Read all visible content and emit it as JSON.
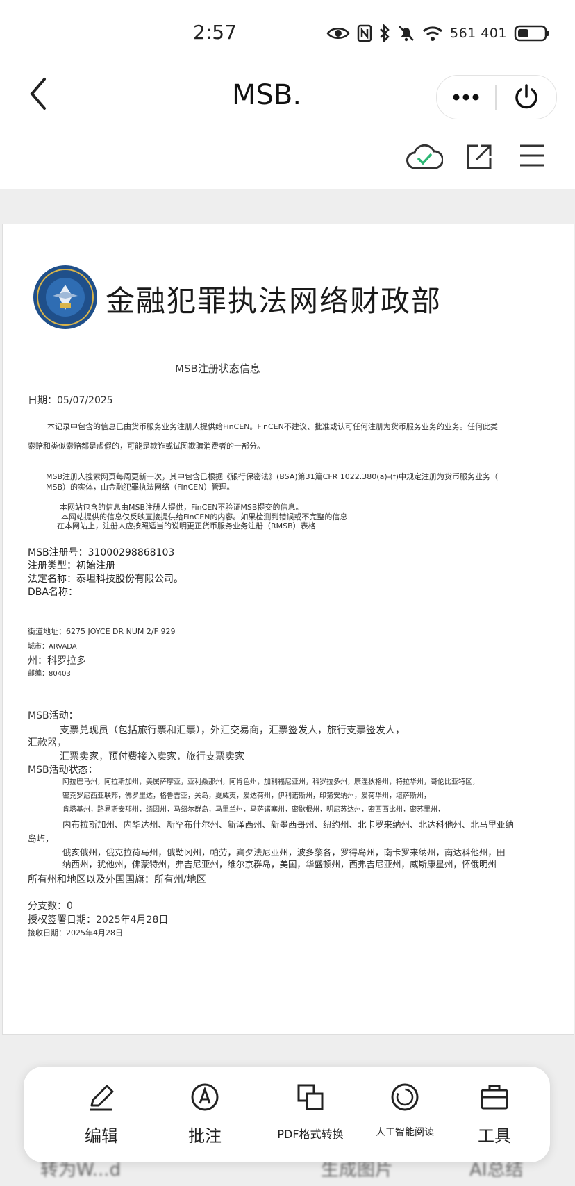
{
  "status_bar": {
    "time": "2:57",
    "network_speed": "561 401"
  },
  "header": {
    "back_icon": "chevron-left-icon",
    "title": "MSB.",
    "more_icon": "more-dots-icon",
    "power_icon": "power-icon",
    "cloud_icon": "cloud-check-icon",
    "share_icon": "share-icon",
    "menu_icon": "menu-icon",
    "cloud_color": "#2bb673"
  },
  "document": {
    "agency_title": "金融犯罪执法网络财政部",
    "seal_lettering": "U.S. TREASURY · FINANCIAL CRIMES ENFORCEMENT NETWORK",
    "subtitle": "MSB注册状态信息",
    "date_line": "日期：05/07/2025",
    "intro_line1": "本记录中包含的信息已由货币服务业务注册人提供给FinCEN。FinCEN不建议、批准或认可任何注册为货币服务业务的业务。任何此类",
    "intro_line2": "索赔和类似索赔都是虚假的，可能是欺诈或试图欺骗消费者的一部分。",
    "search_line1": "MSB注册人搜索网页每周更新一次，其中包含已根据《银行保密法》(BSA)第31篇CFR 1022.380(a)-(f)中规定注册为货币服务业务（",
    "search_line2": "MSB）的实体，由金融犯罪执法网络（FinCEN）管理。",
    "note_line1": "本网站包含的信息由MSB注册人提供，FinCEN不验证MSB提交的信息。",
    "note_line2": "本网站提供的信息仅反映直接提供给FinCEN的内容。如果检测到错误或不完整的信息",
    "note_line3": "在本网站上，注册人应按照适当的说明更正货币服务业务注册（RMSB）表格",
    "reg_number": "MSB注册号：31000298868103",
    "reg_type": "注册类型：初始注册",
    "legal_name": "法定名称：泰坦科技股份有限公司。",
    "dba_name": "DBA名称：",
    "street": "街道地址：6275 JOYCE DR NUM 2/F 929",
    "city": "城市：ARVADA",
    "state": "州：科罗拉多",
    "zip": "邮编：80403",
    "activities_label": "MSB活动：",
    "activities_line1": "支票兑现员（包括旅行票和汇票），外汇交易商，汇票签发人，旅行支票签发人，",
    "activities_line2": "汇款器，",
    "activities_line3": "汇票卖家，预付费接入卖家，旅行支票卖家",
    "status_label": "MSB活动状态：",
    "states_line1": "阿拉巴马州，阿拉斯加州，美属萨摩亚，亚利桑那州，阿肯色州，加利福尼亚州，科罗拉多州，康涅狄格州，特拉华州，哥伦比亚特区，",
    "states_line2": "密克罗尼西亚联邦，佛罗里达，格鲁吉亚，关岛，夏威夷，爱达荷州，伊利诺斯州，印第安纳州，爱荷华州，堪萨斯州，",
    "states_line3": "肯塔基州，路易斯安那州，缅因州，马绍尔群岛，马里兰州，马萨诸塞州，密歇根州，明尼苏达州，密西西比州，密苏里州，",
    "states_line4": "内布拉斯加州、内华达州、新罕布什尔州、新泽西州、新墨西哥州、纽约州、北卡罗来纳州、北达科他州、北马里亚纳",
    "states_line5": "岛屿，",
    "states_line6": "俄亥俄州，俄克拉荷马州，俄勒冈州，帕劳，宾夕法尼亚州，波多黎各，罗得岛州，南卡罗来纳州，南达科他州，田",
    "states_line7": "纳西州，犹他州，佛蒙特州，弗吉尼亚州，维尔京群岛，美国，华盛顿州，西弗吉尼亚州，威斯康星州，怀俄明州",
    "all_states": "所有州和地区以及外国国旗：所有州/地区",
    "branches": "分支数：0",
    "auth_date": "授权签署日期：2025年4月28日",
    "received_date": "接收日期：2025年4月28日"
  },
  "bottom_toolbar": {
    "items": [
      {
        "label": "编辑",
        "icon": "edit-pen-icon"
      },
      {
        "label": "批注",
        "icon": "annotate-icon"
      },
      {
        "label": "PDF格式转换",
        "icon": "convert-icon"
      },
      {
        "label": "人工智能阅读",
        "icon": "ai-read-icon"
      },
      {
        "label": "工具",
        "icon": "toolbox-icon"
      }
    ]
  },
  "under_row": {
    "left": "转为W...d",
    "center": "生成图片",
    "right": "AI总结"
  }
}
